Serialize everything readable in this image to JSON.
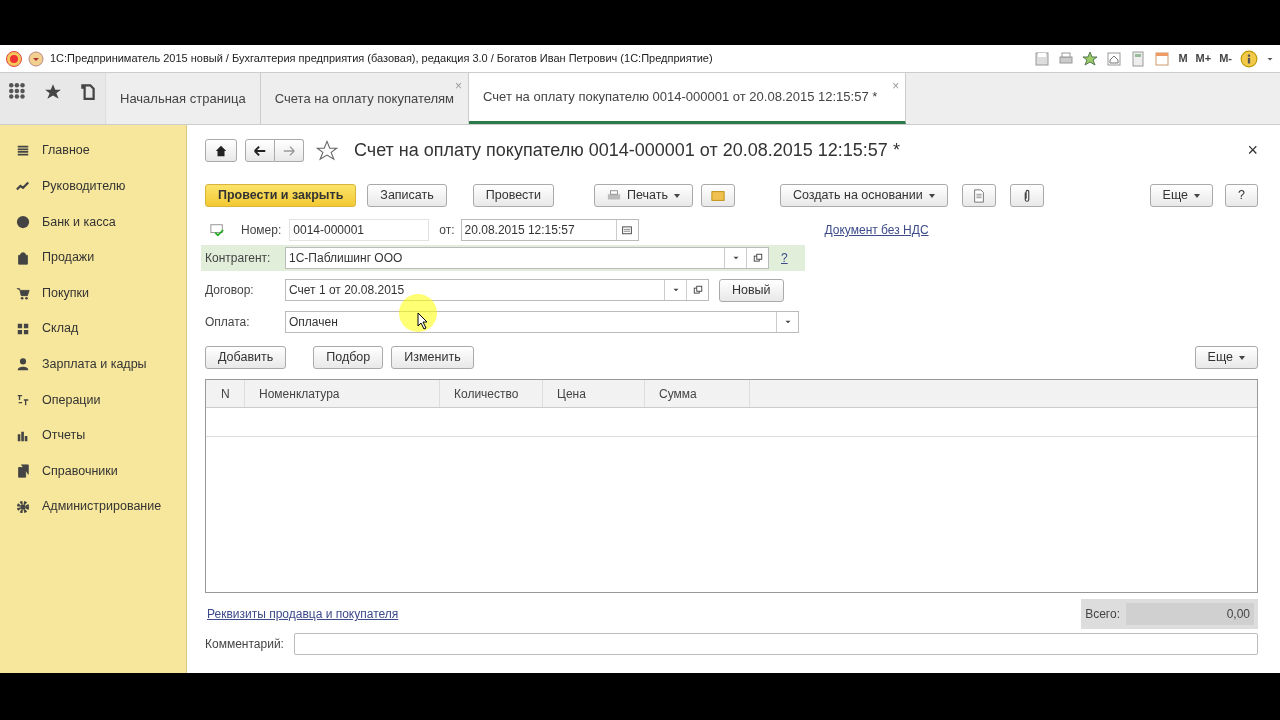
{
  "title_bar": {
    "title": "1С:Предприниматель 2015 новый / Бухгалтерия предприятия (базовая), редакция 3.0 / Богатов Иван Петрович   (1С:Предприятие)",
    "memory_buttons": [
      "M",
      "M+",
      "M-"
    ]
  },
  "tabs": [
    {
      "label": "Начальная страница",
      "selected": false
    },
    {
      "label": "Счета на оплату покупателям",
      "selected": false,
      "close": "×"
    },
    {
      "label": "Счет на оплату покупателю 0014-000001 от 20.08.2015 12:15:57 *",
      "selected": true,
      "close": "×"
    }
  ],
  "sidebar": {
    "items": [
      {
        "label": "Главное"
      },
      {
        "label": "Руководителю"
      },
      {
        "label": "Банк и касса"
      },
      {
        "label": "Продажи"
      },
      {
        "label": "Покупки"
      },
      {
        "label": "Склад"
      },
      {
        "label": "Зарплата и кадры"
      },
      {
        "label": "Операции"
      },
      {
        "label": "Отчеты"
      },
      {
        "label": "Справочники"
      },
      {
        "label": "Администрирование"
      }
    ]
  },
  "form": {
    "close": "×",
    "title": "Счет на оплату покупателю 0014-000001 от 20.08.2015 12:15:57 *",
    "toolbar": [
      {
        "kind": "primary",
        "label": "Провести и закрыть"
      },
      {
        "kind": "plain",
        "label": "Записать"
      },
      {
        "kind": "plain",
        "label": "Провести"
      },
      {
        "kind": "print",
        "label": "Печать"
      },
      {
        "kind": "mail"
      },
      {
        "kind": "dropdown",
        "label": "Создать на основании"
      },
      {
        "kind": "doc"
      },
      {
        "kind": "clip"
      },
      {
        "kind": "spacer"
      },
      {
        "kind": "dropdown",
        "label": "Еще"
      },
      {
        "kind": "plain",
        "label": "?"
      }
    ],
    "number": {
      "label": "Номер:",
      "value": "0014-000001"
    },
    "date": {
      "label": "от:",
      "value": "20.08.2015 12:15:57"
    },
    "vat_link": "Документ без НДС",
    "counterparty": {
      "label": "Контрагент:",
      "value": "1С-Паблишинг ООО",
      "highlighted": true,
      "help": "?"
    },
    "contract": {
      "label": "Договор:",
      "value": "Счет 1 от 20.08.2015",
      "button": "Новый"
    },
    "payment": {
      "label": "Оплата:",
      "value": "Оплачен"
    },
    "table_toolbar": [
      "Добавить",
      "Подбор",
      "Изменить"
    ],
    "table_more": "Еще",
    "table": {
      "columns": [
        "N",
        "Номенклатура",
        "Количество",
        "Цена",
        "Сумма"
      ]
    },
    "details_link": "Реквизиты продавца и покупателя",
    "total": {
      "label": "Всего:",
      "value": "0,00"
    },
    "comment": {
      "label": "Комментарий:"
    }
  }
}
